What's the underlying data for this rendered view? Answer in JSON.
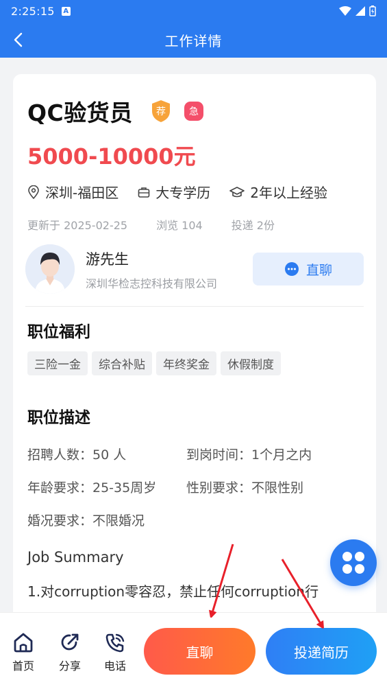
{
  "status_bar": {
    "time": "2:25:15",
    "notification_badge": "A"
  },
  "header": {
    "title": "工作详情"
  },
  "job": {
    "title": "QC验货员",
    "badge_recommend": "荐",
    "badge_urgent": "急",
    "salary": "5000-10000元",
    "location": "深圳-福田区",
    "education": "大专学历",
    "experience": "2年以上经验",
    "updated": "更新于 2025-02-25",
    "views": "浏览 104",
    "applications": "投递 2份"
  },
  "contact": {
    "name": "游先生",
    "company": "深圳华检志控科技有限公司",
    "chat_label": "直聊"
  },
  "benefits": {
    "title": "职位福利",
    "tags": [
      "三险一金",
      "综合补贴",
      "年终奖金",
      "休假制度"
    ]
  },
  "description": {
    "title": "职位描述",
    "rows": [
      [
        "招聘人数：50 人",
        "到岗时间：1个月之内"
      ],
      [
        "年龄要求：25-35周岁",
        "性别要求：不限性别"
      ],
      [
        "婚况要求：不限婚况",
        ""
      ]
    ],
    "summary_title": "Job Summary",
    "summary_line": "1.对corruption零容忍，禁止任何corruption行"
  },
  "bottom_nav": {
    "home": "首页",
    "share": "分享",
    "phone": "电话",
    "chat_button": "直聊",
    "apply_button": "投递简历"
  },
  "colors": {
    "primary": "#2b7bf0",
    "salary": "#f04a4f",
    "chat_gradient_start": "#ff5a4a",
    "chat_gradient_end": "#ff7a2a",
    "annotation_arrow": "#e8202a"
  }
}
